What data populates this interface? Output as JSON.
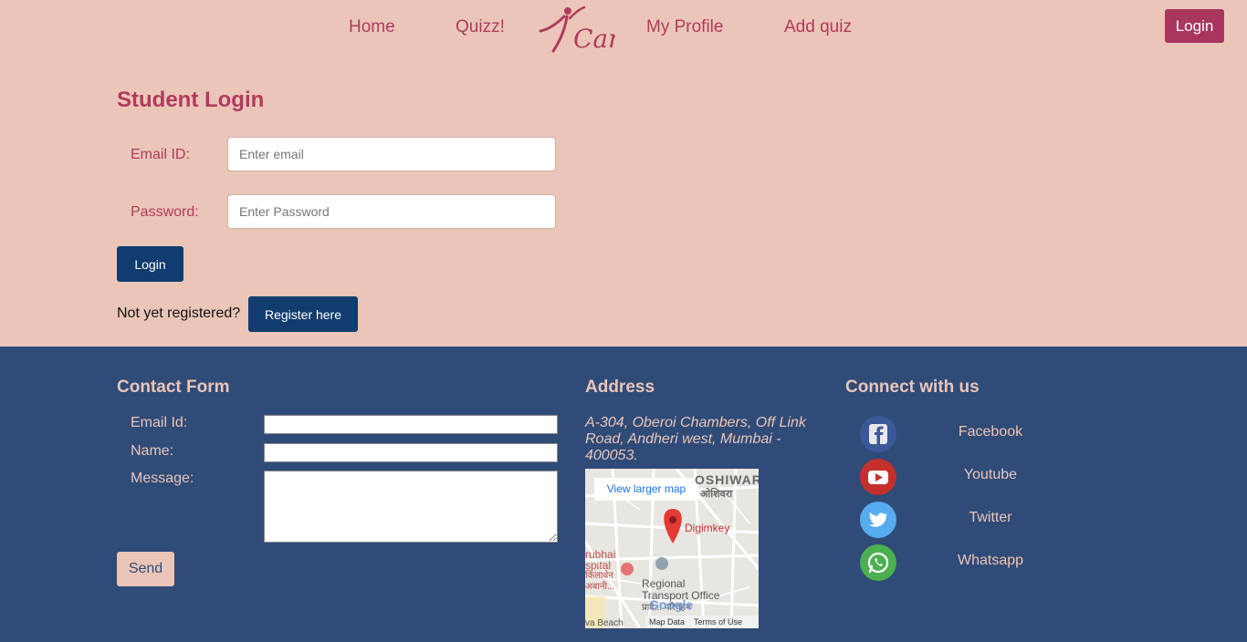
{
  "nav": {
    "home": "Home",
    "quizz": "Quizz!",
    "logo_text": "Can",
    "profile": "My Profile",
    "add_quiz": "Add quiz",
    "login": "Login"
  },
  "login_form": {
    "title": "Student Login",
    "email_label": "Email ID:",
    "email_placeholder": "Enter email",
    "password_label": "Password:",
    "password_placeholder": "Enter Password",
    "login_button": "Login",
    "not_registered": "Not yet registered?",
    "register_button": "Register here"
  },
  "contact": {
    "title": "Contact Form",
    "email_label": "Email Id:",
    "name_label": "Name:",
    "message_label": "Message:",
    "send_button": "Send"
  },
  "address": {
    "title": "Address",
    "text": "A-304, Oberoi Chambers, Off Link Road, Andheri west, Mumbai - 400053.",
    "map": {
      "larger_map": "View larger map",
      "area_name": "OSHIWARA",
      "area_name_local": "ओशिवरा",
      "place_name": "Digimkey",
      "poi_1_line1": "rubhai",
      "poi_1_line2": "spital",
      "poi_1_line3": "किलाबेन",
      "poi_1_line4": "अबानी...",
      "poi_2_line1": "Regional",
      "poi_2_line2": "Transport Office",
      "poi_2_line3": "प्रादे... परिवहन",
      "beach": "va Beach",
      "google": "Google",
      "map_data": "Map Data",
      "terms": "Terms of Use"
    }
  },
  "connect": {
    "title": "Connect with us",
    "items": [
      {
        "label": "Facebook",
        "color": "#3b5998"
      },
      {
        "label": "Youtube",
        "color": "#c4302b"
      },
      {
        "label": "Twitter",
        "color": "#55acee"
      },
      {
        "label": "Whatsapp",
        "color": "#4caf50"
      }
    ]
  },
  "colors": {
    "page_bg": "#ebc6b8",
    "accent": "#b03a5e",
    "footer_bg": "#2f4b78",
    "button_blue": "#123c6e"
  }
}
